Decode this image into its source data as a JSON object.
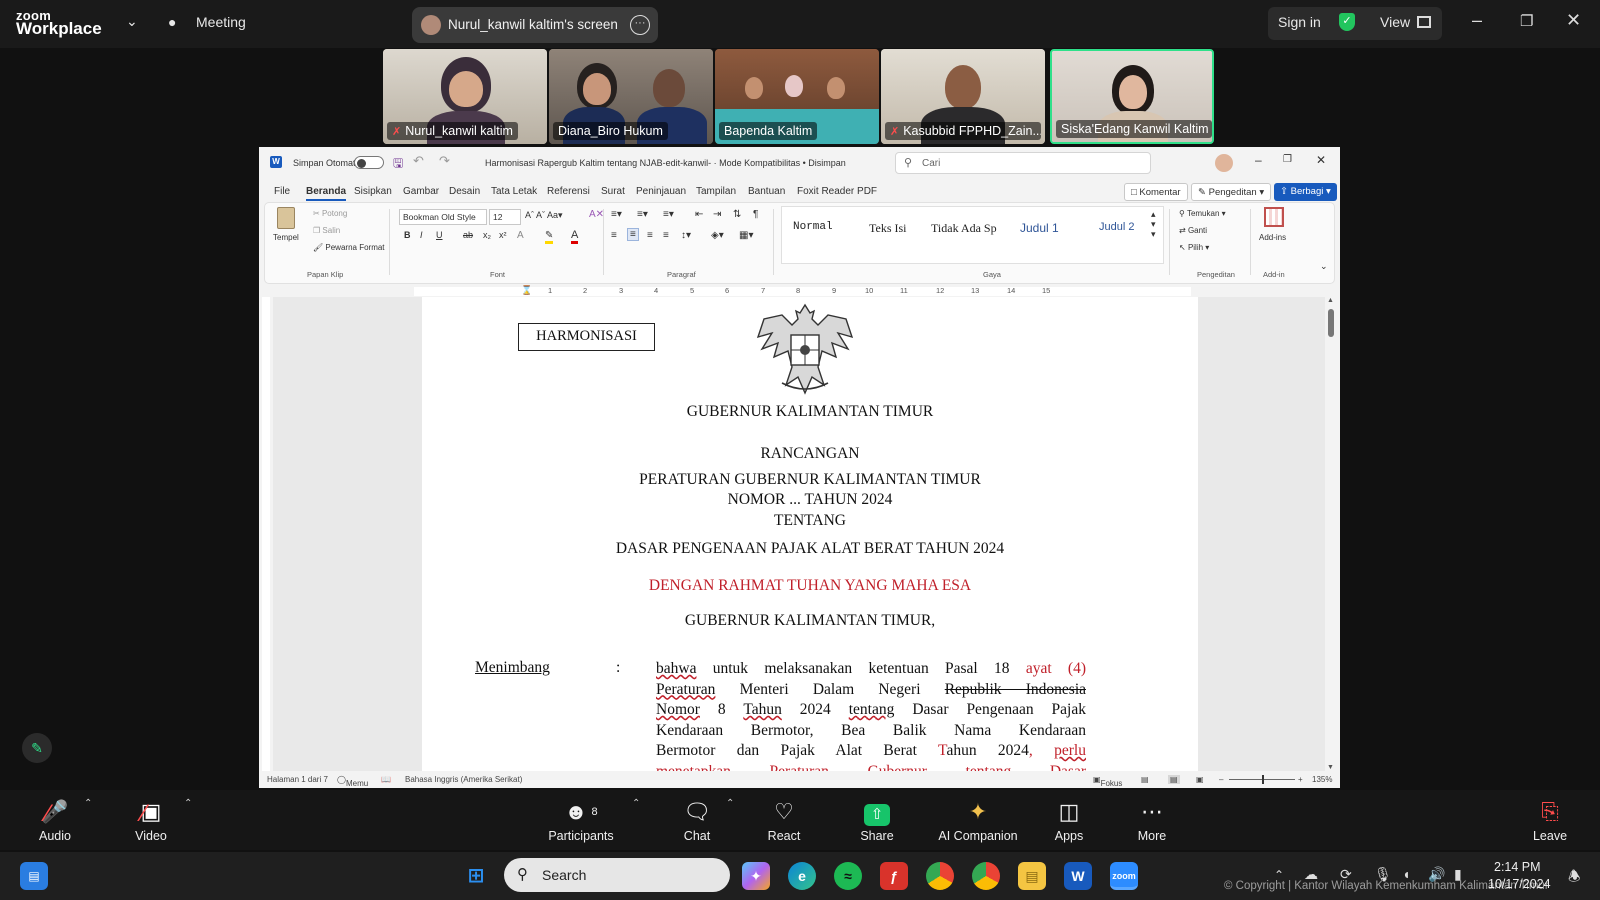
{
  "zoom": {
    "brand_top": "zoom",
    "brand_bottom": "Workplace",
    "meeting_label": "Meeting",
    "share_pill": "Nurul_kanwil kaltim's screen",
    "sign_in": "Sign in",
    "view": "View",
    "participants": [
      {
        "name": "Nurul_kanwil kaltim",
        "muted": true,
        "active": false
      },
      {
        "name": "Diana_Biro Hukum",
        "muted": false,
        "active": false
      },
      {
        "name": "Bapenda Kaltim",
        "muted": false,
        "active": false
      },
      {
        "name": "Kasubbid FPPHD_Zain...",
        "muted": true,
        "active": false
      },
      {
        "name": "Siska'Edang Kanwil Kaltim",
        "muted": false,
        "active": true
      }
    ],
    "toolbar": {
      "audio": "Audio",
      "video": "Video",
      "participants": "Participants",
      "participants_count": "8",
      "chat": "Chat",
      "react": "React",
      "share": "Share",
      "ai_companion": "AI Companion",
      "apps": "Apps",
      "more": "More",
      "leave": "Leave"
    }
  },
  "word": {
    "autosave_label": "Simpan Otomatis",
    "doc_title": "Harmonisasi Rapergub Kaltim tentang NJAB-edit-kanwil- · Mode Kompatibilitas • Disimpan",
    "search_placeholder": "Cari",
    "menu": [
      "File",
      "Beranda",
      "Sisipkan",
      "Gambar",
      "Desain",
      "Tata Letak",
      "Referensi",
      "Surat",
      "Peninjauan",
      "Tampilan",
      "Bantuan",
      "Foxit Reader PDF"
    ],
    "comment_btn": "Komentar",
    "editing_btn": "Pengeditan",
    "share_btn": "Berbagi",
    "ribbon": {
      "paste": "Tempel",
      "cut": "Potong",
      "copy": "Salin",
      "format_painter": "Pewarna Format",
      "clipboard_group": "Papan Klip",
      "font_name": "Bookman Old Style",
      "font_size": "12",
      "font_group": "Font",
      "paragraph_group": "Paragraf",
      "styles": [
        "Normal",
        "Teks Isi",
        "Tidak Ada Sp",
        "Judul 1",
        "Judul 2"
      ],
      "styles_group": "Gaya",
      "find": "Temukan",
      "replace": "Ganti",
      "select": "Pilih",
      "editing_group": "Pengeditan",
      "addins": "Add-ins",
      "addin_group": "Add-in"
    },
    "ruler_numbers": [
      "1",
      "2",
      "3",
      "4",
      "5",
      "6",
      "7",
      "8",
      "9",
      "10",
      "11",
      "12",
      "13",
      "14",
      "15"
    ],
    "document": {
      "stamp": "HARMONISASI",
      "governor": "GUBERNUR KALIMANTAN TIMUR",
      "rancangan": "RANCANGAN",
      "regulation": "PERATURAN GUBERNUR KALIMANTAN TIMUR",
      "nomor": "NOMOR ... TAHUN  2024",
      "tentang": "TENTANG",
      "subject": "DASAR PENGENAAN PAJAK ALAT BERAT TAHUN 2024",
      "rahmat": "DENGAN RAHMAT TUHAN YANG MAHA ESA",
      "governor2": "GUBERNUR KALIMANTAN TIMUR,",
      "menimbang": "Menimbang",
      "colon": ":"
    },
    "status": {
      "page": "Halaman 1 dari 7",
      "notes": "Memu",
      "language": "Bahasa Inggris (Amerika Serikat)",
      "focus": "Fokus",
      "zoom": "135%"
    }
  },
  "taskbar": {
    "search": "Search",
    "time": "2:14 PM",
    "date": "10/17/2024",
    "copyright": "© Copyright | Kantor Wilayah Kemenkumham Kalimantan Timur"
  },
  "colors": {
    "accent_word": "#185abd",
    "zoom_active_tile": "#2fe08a",
    "share_green": "#17c46a",
    "leave_red": "#ff4d4d",
    "doc_red": "#c0202a"
  }
}
